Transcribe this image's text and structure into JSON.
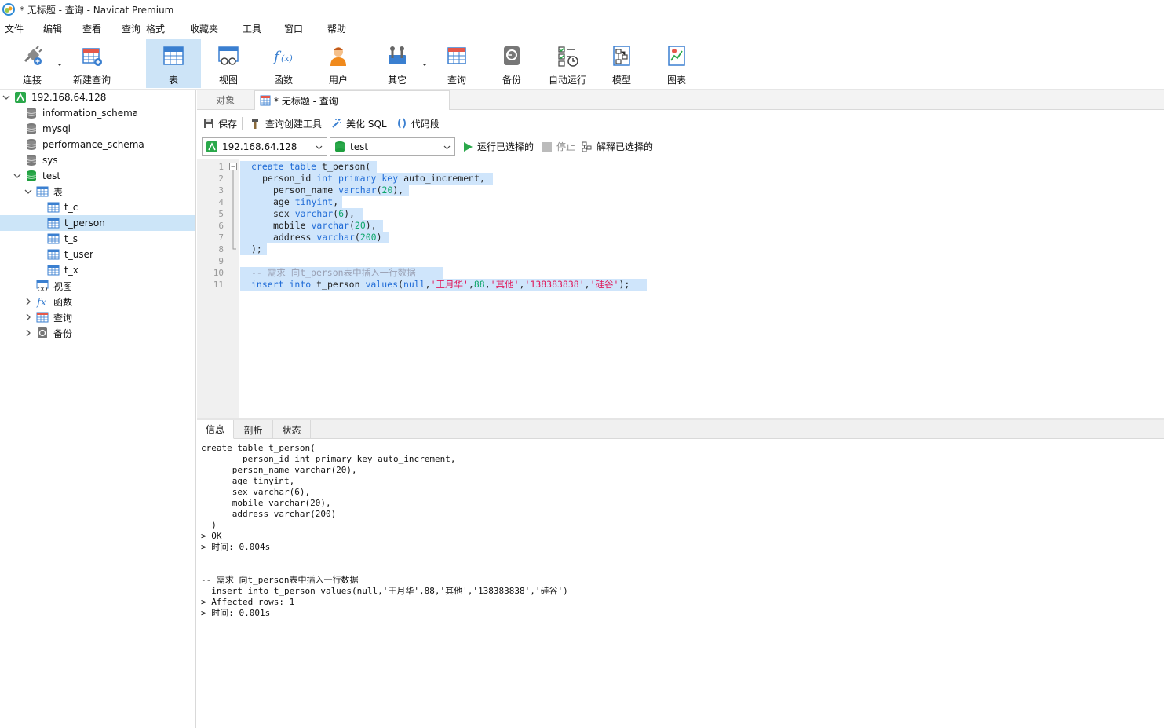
{
  "window": {
    "title": "* 无标题 - 查询 - Navicat Premium"
  },
  "menu": [
    "文件",
    "编辑",
    "查看",
    "查询",
    "格式",
    "收藏夹",
    "工具",
    "窗口",
    "帮助"
  ],
  "toolbar": {
    "buttons": [
      {
        "label": "连接",
        "icon": "connect-icon"
      },
      {
        "label": "新建查询",
        "icon": "new-query-icon"
      },
      {
        "label": "表",
        "icon": "table-icon"
      },
      {
        "label": "视图",
        "icon": "view-icon"
      },
      {
        "label": "函数",
        "icon": "function-icon"
      },
      {
        "label": "用户",
        "icon": "user-icon"
      },
      {
        "label": "其它",
        "icon": "other-icon"
      },
      {
        "label": "查询",
        "icon": "query-icon"
      },
      {
        "label": "备份",
        "icon": "backup-icon"
      },
      {
        "label": "自动运行",
        "icon": "automation-icon"
      },
      {
        "label": "模型",
        "icon": "model-icon"
      },
      {
        "label": "图表",
        "icon": "chart-icon"
      }
    ],
    "active": "表"
  },
  "tree": {
    "connection": "192.168.64.128",
    "databases": [
      "information_schema",
      "mysql",
      "performance_schema",
      "sys",
      "test"
    ],
    "test_children": {
      "tables_label": "表",
      "tables": [
        "t_c",
        "t_person",
        "t_s",
        "t_user",
        "t_x"
      ],
      "selected_table": "t_person",
      "views_label": "视图",
      "functions_label": "函数",
      "queries_label": "查询",
      "backups_label": "备份"
    }
  },
  "tabs": {
    "objects": "对象",
    "query": "* 无标题 - 查询"
  },
  "query_toolbar": {
    "save": "保存",
    "query_builder": "查询创建工具",
    "beautify": "美化 SQL",
    "snippet": "代码段"
  },
  "connection_bar": {
    "connection": "192.168.64.128",
    "database": "test",
    "run_selected": "运行已选择的",
    "stop": "停止",
    "explain_selected": "解释已选择的"
  },
  "editor": {
    "line_numbers": [
      "1",
      "2",
      "3",
      "4",
      "5",
      "6",
      "7",
      "8",
      "9",
      "10",
      "11"
    ]
  },
  "bottom_tabs": [
    "信息",
    "剖析",
    "状态"
  ],
  "messages": [
    "create table t_person(",
    "        person_id int primary key auto_increment,",
    "      person_name varchar(20),",
    "      age tinyint,",
    "      sex varchar(6),",
    "      mobile varchar(20),",
    "      address varchar(200)",
    "  )",
    "> OK",
    "> 时间: 0.004s",
    "",
    "",
    "-- 需求 向t_person表中插入一行数据",
    "  insert into t_person values(null,'王月华',88,'其他','138383838','硅谷')",
    "> Affected rows: 1",
    "> 时间: 0.001s"
  ],
  "colors": {
    "keyword": "#1f6bd6",
    "number": "#0ea66b",
    "string": "#e0195a",
    "comment": "#9aa0b3",
    "selection": "#cfe5fb",
    "toolbar_active": "#cde4f7"
  }
}
